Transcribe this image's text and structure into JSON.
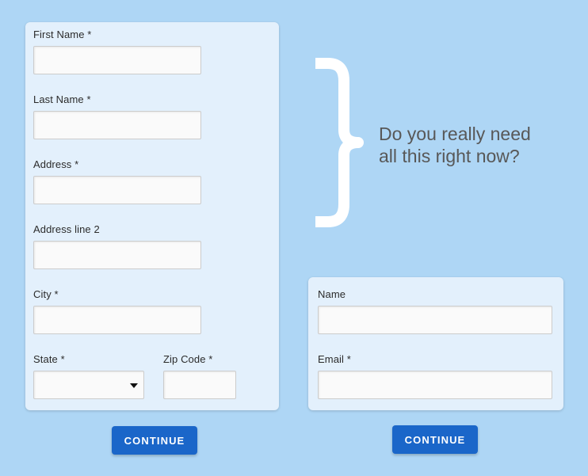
{
  "page": {
    "background_color": "#aed6f5",
    "card_color": "#e3f0fc",
    "accent_color": "#1a66c9",
    "callout_text_color": "#585858"
  },
  "long_form": {
    "fields": [
      {
        "label": "First Name *",
        "value": "",
        "placeholder": "",
        "type": "text"
      },
      {
        "label": "Last Name *",
        "value": "",
        "placeholder": "",
        "type": "text"
      },
      {
        "label": "Address *",
        "value": "",
        "placeholder": "",
        "type": "text"
      },
      {
        "label": "Address line 2",
        "value": "",
        "placeholder": "",
        "type": "text"
      },
      {
        "label": "City *",
        "value": "",
        "placeholder": "",
        "type": "text"
      },
      {
        "label": "State *",
        "value": "",
        "placeholder": "",
        "type": "select",
        "selected_option": ""
      },
      {
        "label": "Zip Code *",
        "value": "",
        "placeholder": "",
        "type": "text"
      }
    ],
    "submit_label": "CONTINUE"
  },
  "short_form": {
    "fields": [
      {
        "label": "Name",
        "value": "",
        "placeholder": "",
        "type": "text"
      },
      {
        "label": "Email *",
        "value": "",
        "placeholder": "",
        "type": "text"
      }
    ],
    "submit_label": "CONTINUE"
  },
  "callout": {
    "brace_icon": "curly-brace-icon",
    "text": "Do you really need\nall this right now?"
  }
}
